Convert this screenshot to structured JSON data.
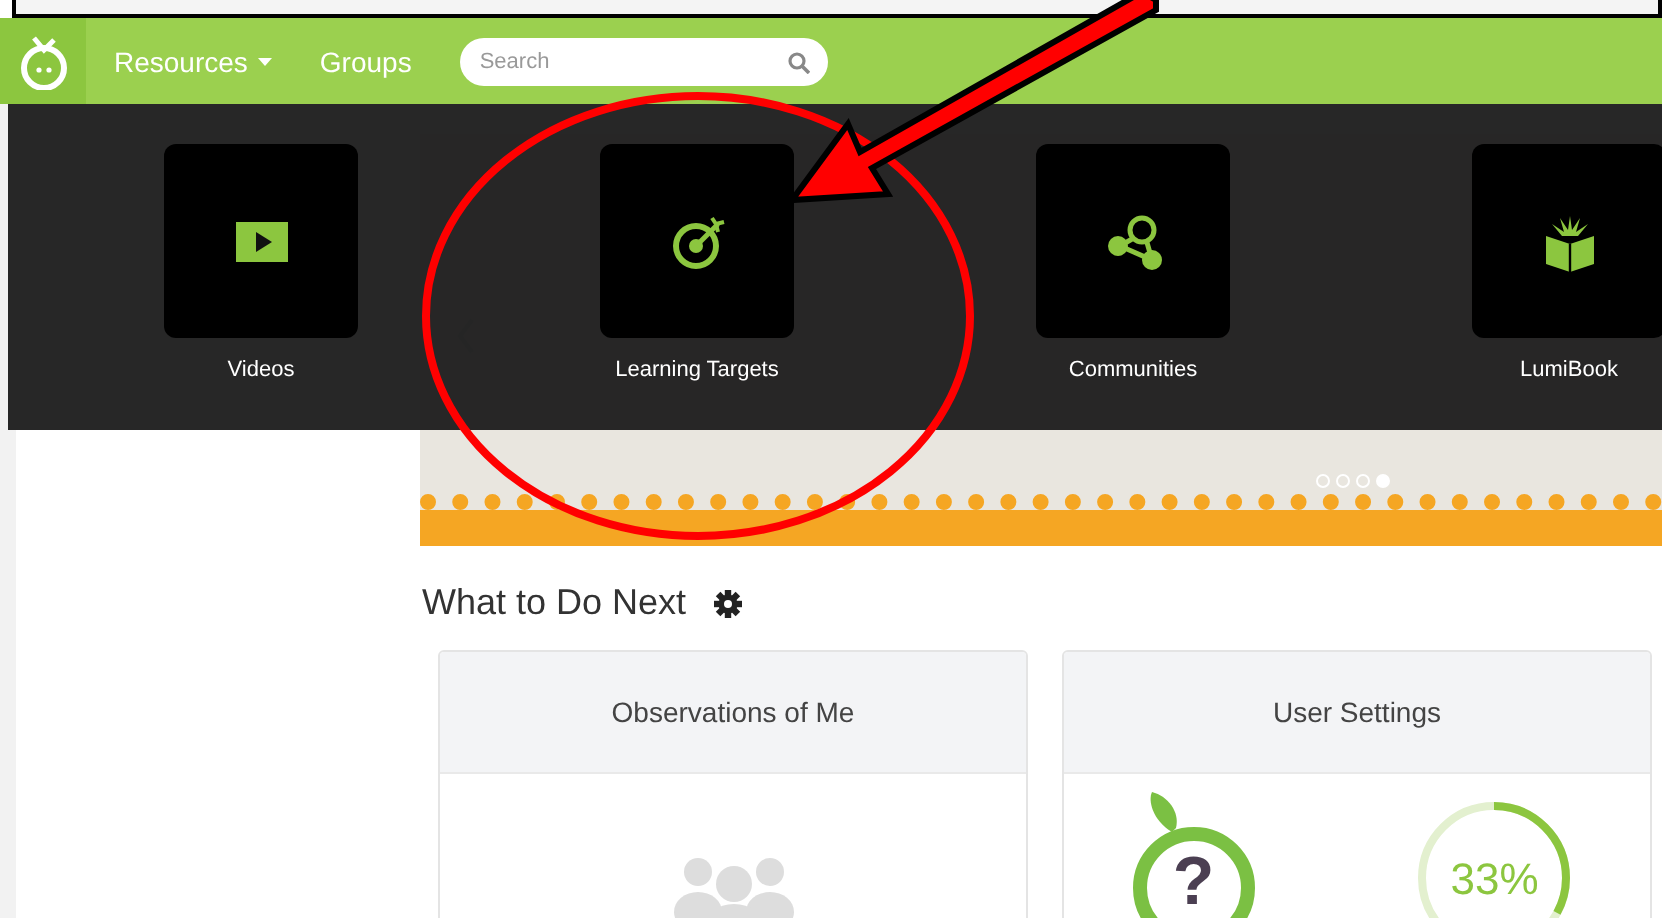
{
  "nav": {
    "items": [
      {
        "label": "Resources",
        "dropdown": true
      },
      {
        "label": "Groups",
        "dropdown": false
      }
    ],
    "search": {
      "placeholder": "Search"
    }
  },
  "resources_menu": {
    "tiles": [
      {
        "label": "Videos",
        "kind": "video"
      },
      {
        "label": "Learning Targets",
        "kind": "target"
      },
      {
        "label": "Communities",
        "kind": "community"
      },
      {
        "label": "LumiBook",
        "kind": "book"
      }
    ]
  },
  "banner": {
    "slides": [
      {
        "selected": false
      },
      {
        "selected": false
      },
      {
        "selected": false
      },
      {
        "selected": true
      }
    ]
  },
  "next_section": {
    "title": "What to Do Next",
    "cards": [
      {
        "title": "Observations of Me",
        "kind": "observations"
      },
      {
        "title": "User Settings",
        "kind": "settings",
        "mark": "?",
        "progress": {
          "level": 0.33,
          "reading": "33%"
        }
      }
    ]
  },
  "annotations": [
    {
      "kind": "circle"
    },
    {
      "kind": "arrow"
    }
  ]
}
